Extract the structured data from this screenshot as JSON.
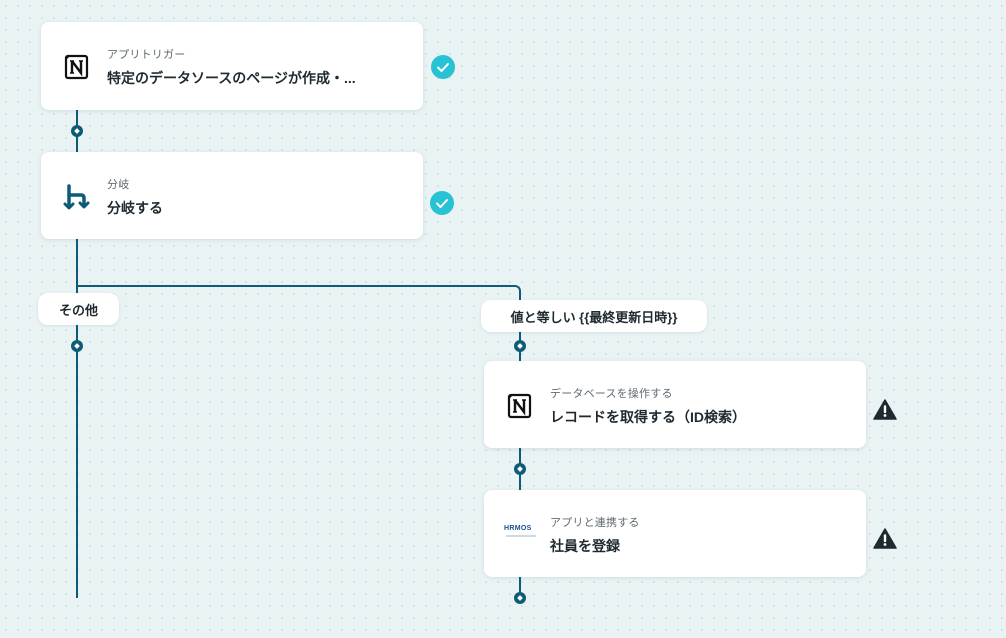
{
  "flow": {
    "trigger": {
      "subtitle": "アプリトリガー",
      "title": "特定のデータソースのページが作成・...",
      "icon": "notion-icon",
      "status": "check-icon"
    },
    "branch": {
      "subtitle": "分岐",
      "title": "分岐する",
      "icon": "branch-icon",
      "status": "check-icon"
    },
    "branch_labels": {
      "other": "その他",
      "condition": "値と等しい {{最終更新日時}}"
    },
    "notion_action": {
      "subtitle": "データベースを操作する",
      "title": "レコードを取得する（ID検索）",
      "icon": "notion-icon",
      "status": "warning-icon"
    },
    "hrmos_action": {
      "subtitle": "アプリと連携する",
      "title": "社員を登録",
      "icon": "hrmos-logo",
      "logo_text": "HRMOS",
      "status": "warning-icon"
    }
  },
  "colors": {
    "connector": "#0e5b78",
    "success": "#27c2d3",
    "warning": "#1f2a30",
    "canvas": "#e9f3f4"
  }
}
